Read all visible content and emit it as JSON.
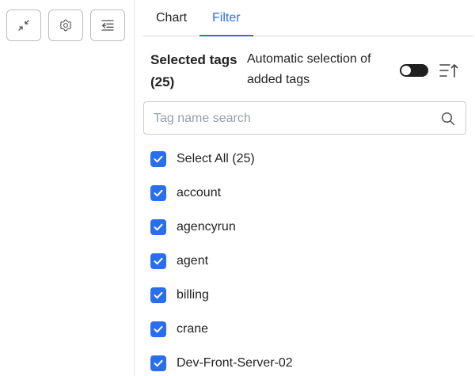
{
  "toolbar": {
    "buttons": [
      {
        "name": "collapse-button",
        "icon": "collapse-arrows-icon"
      },
      {
        "name": "settings-button",
        "icon": "gear-icon"
      },
      {
        "name": "panel-toggle-button",
        "icon": "indent-left-icon"
      }
    ]
  },
  "tabs": {
    "chart": "Chart",
    "filter": "Filter",
    "active": "filter"
  },
  "selection": {
    "title": "Selected tags",
    "count": "(25)",
    "auto_label": "Automatic selection of added tags",
    "auto_enabled": false
  },
  "search": {
    "placeholder": "Tag name search",
    "value": ""
  },
  "tags": [
    {
      "label": "Select All (25)",
      "checked": true
    },
    {
      "label": "account",
      "checked": true
    },
    {
      "label": "agencyrun",
      "checked": true
    },
    {
      "label": "agent",
      "checked": true
    },
    {
      "label": "billing",
      "checked": true
    },
    {
      "label": "crane",
      "checked": true
    },
    {
      "label": "Dev-Front-Server-02",
      "checked": true
    }
  ],
  "colors": {
    "accent": "#2f6fdb",
    "checkbox": "#2a6ef0",
    "toggle_off": "#1f1f1f"
  }
}
